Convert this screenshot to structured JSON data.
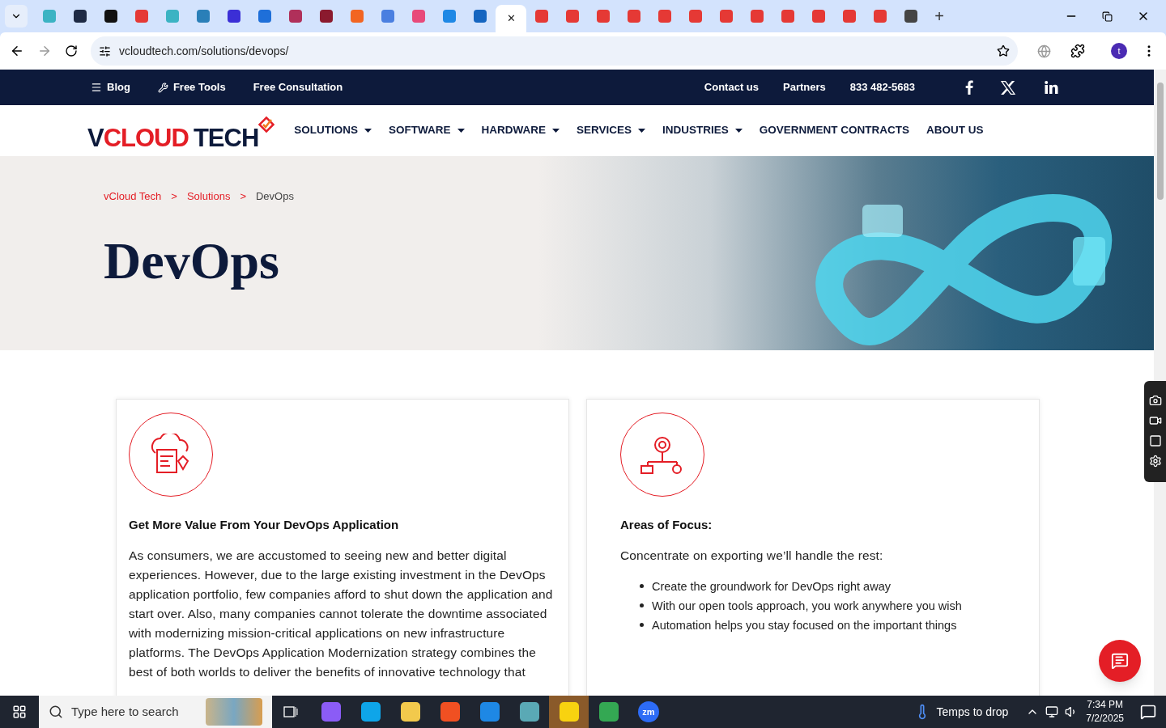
{
  "browser": {
    "tabs": [
      {
        "selected": false,
        "color": "#3bb3c3"
      },
      {
        "selected": false,
        "color": "#1e2a44"
      },
      {
        "selected": false,
        "color": "#111111"
      },
      {
        "selected": false,
        "color": "#e53935"
      },
      {
        "selected": false,
        "color": "#3bb3c3"
      },
      {
        "selected": false,
        "color": "#2a7fb8"
      },
      {
        "selected": false,
        "color": "#3b2fd6"
      },
      {
        "selected": false,
        "color": "#1e6fd9"
      },
      {
        "selected": false,
        "color": "#b0305a"
      },
      {
        "selected": false,
        "color": "#8b1a2e"
      },
      {
        "selected": false,
        "color": "#f26522"
      },
      {
        "selected": false,
        "color": "#4a7fe0"
      },
      {
        "selected": false,
        "color": "#e84a7a"
      },
      {
        "selected": false,
        "color": "#1e88e5"
      },
      {
        "selected": false,
        "color": "#1565c0"
      },
      {
        "selected": true,
        "close": "✕"
      },
      {
        "selected": false,
        "color": "#e53935"
      },
      {
        "selected": false,
        "color": "#e53935"
      },
      {
        "selected": false,
        "color": "#e53935"
      },
      {
        "selected": false,
        "color": "#e53935"
      },
      {
        "selected": false,
        "color": "#e53935"
      },
      {
        "selected": false,
        "color": "#e53935"
      },
      {
        "selected": false,
        "color": "#e53935"
      },
      {
        "selected": false,
        "color": "#e53935"
      },
      {
        "selected": false,
        "color": "#e53935"
      },
      {
        "selected": false,
        "color": "#e53935"
      },
      {
        "selected": false,
        "color": "#e53935"
      },
      {
        "selected": false,
        "color": "#e53935"
      },
      {
        "selected": false,
        "color": "#444444"
      }
    ],
    "new_tab": "+",
    "url": "vcloudtech.com/solutions/devops/",
    "profile": "t"
  },
  "top_bar": {
    "left": [
      "Blog",
      "Free Tools",
      "Free Consultation"
    ],
    "right": [
      "Contact us",
      "Partners",
      "833 482-5683"
    ]
  },
  "logo": {
    "part_1": "V",
    "part_2": "CLOUD",
    "part_3": "TECH"
  },
  "nav": [
    {
      "label": "SOLUTIONS",
      "dropdown": true
    },
    {
      "label": "SOFTWARE",
      "dropdown": true
    },
    {
      "label": "HARDWARE",
      "dropdown": true
    },
    {
      "label": "SERVICES",
      "dropdown": true
    },
    {
      "label": "INDUSTRIES",
      "dropdown": true
    },
    {
      "label": "GOVERNMENT CONTRACTS",
      "dropdown": false
    },
    {
      "label": "ABOUT US",
      "dropdown": false
    }
  ],
  "breadcrumb": {
    "items": [
      "vCloud Tech",
      "Solutions"
    ],
    "separator": ">",
    "current": "DevOps"
  },
  "hero_title": "DevOps",
  "cards": [
    {
      "kind": "paragraph",
      "title": "Get More Value From Your DevOps Application",
      "text": "As consumers, we are accustomed to seeing new and better digital experiences. However, due to the large existing investment in the DevOps application portfolio, few companies afford to shut down the application and start over. Also, many companies cannot tolerate the downtime associated with modernizing mission-critical applications on new infrastructure platforms. The DevOps Application Modernization strategy combines the best of both worlds to deliver the benefits of innovative technology that"
    },
    {
      "kind": "list",
      "title": "Areas of Focus:",
      "text": "Concentrate on exporting we’ll handle the rest:",
      "bullets": [
        "Create the groundwork for DevOps right away",
        "With our open tools approach, you work anywhere you wish",
        "Automation helps you stay focused on the important things"
      ]
    }
  ],
  "taskbar": {
    "search_placeholder": "Type here to search",
    "weather": "Temps to drop",
    "time": "7:34 PM",
    "date": "7/2/2025",
    "zoom_label": "zm"
  }
}
